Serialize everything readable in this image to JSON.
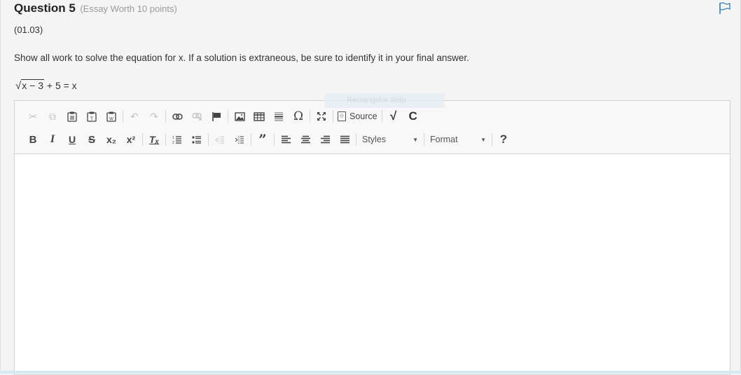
{
  "question": {
    "title": "Question 5",
    "worth": "(Essay Worth 10 points)",
    "code": "(01.03)",
    "prompt": "Show all work to solve the equation for x. If a solution is extraneous, be sure to identify it in your final answer.",
    "equation": {
      "radical_symbol": "√",
      "radicand": "x − 3",
      "rest": " + 5 = x"
    },
    "flag_icon": "flag-icon"
  },
  "overlay": {
    "snip_label": "Rectangular Snip"
  },
  "colors": {
    "accent": "#3b7fc4",
    "background": "#f4f4f4",
    "toolbar_bg": "#f8f8f8",
    "border": "#d1d1d1"
  },
  "toolbar": {
    "row1": [
      {
        "name": "cut-button",
        "icon": "✂",
        "title": "Cut",
        "disabled": true
      },
      {
        "name": "copy-button",
        "icon": "⧉",
        "title": "Copy",
        "disabled": true
      },
      {
        "name": "paste-button",
        "icon": "📋",
        "title": "Paste",
        "disabled": false
      },
      {
        "name": "paste-text-button",
        "icon": "T",
        "title": "Paste as plain text",
        "disabled": false
      },
      {
        "name": "paste-word-button",
        "icon": "W",
        "title": "Paste from Word",
        "disabled": false
      },
      {
        "name": "undo-button",
        "icon": "↶",
        "title": "Undo",
        "disabled": true
      },
      {
        "name": "redo-button",
        "icon": "↷",
        "title": "Redo",
        "disabled": true
      },
      {
        "name": "link-button",
        "icon": "🔗",
        "title": "Link",
        "disabled": false
      },
      {
        "name": "unlink-button",
        "icon": "⛓",
        "title": "Unlink",
        "disabled": true
      },
      {
        "name": "anchor-button",
        "icon": "⚑",
        "title": "Anchor",
        "disabled": false
      },
      {
        "name": "image-button",
        "icon": "🖼",
        "title": "Image",
        "disabled": false
      },
      {
        "name": "table-button",
        "icon": "▦",
        "title": "Table",
        "disabled": false
      },
      {
        "name": "horizontal-line-button",
        "icon": "☰",
        "title": "Insert Horizontal Line",
        "disabled": false
      },
      {
        "name": "special-char-button",
        "icon": "Ω",
        "title": "Insert Special Character",
        "disabled": false
      },
      {
        "name": "maximize-button",
        "icon": "⤢",
        "title": "Maximize",
        "disabled": false
      }
    ],
    "source_label": "Source",
    "sqrt_icon": "√",
    "c_icon": "C",
    "row2": [
      {
        "name": "bold-button",
        "icon": "B",
        "title": "Bold"
      },
      {
        "name": "italic-button",
        "icon": "I",
        "title": "Italic"
      },
      {
        "name": "underline-button",
        "icon": "U",
        "title": "Underline"
      },
      {
        "name": "strike-button",
        "icon": "S",
        "title": "Strikethrough"
      },
      {
        "name": "subscript-button",
        "icon": "x₂",
        "title": "Subscript"
      },
      {
        "name": "superscript-button",
        "icon": "x²",
        "title": "Superscript"
      },
      {
        "name": "remove-format-button",
        "icon": "Tₓ",
        "title": "Remove Format"
      },
      {
        "name": "numbered-list-button",
        "icon": "≔",
        "title": "Insert/Remove Numbered List"
      },
      {
        "name": "bulleted-list-button",
        "icon": "⁝≡",
        "title": "Insert/Remove Bulleted List"
      },
      {
        "name": "outdent-button",
        "icon": "⇤",
        "title": "Decrease Indent",
        "disabled": true
      },
      {
        "name": "indent-button",
        "icon": "⇥",
        "title": "Increase Indent"
      },
      {
        "name": "blockquote-button",
        "icon": "❞",
        "title": "Block Quote"
      },
      {
        "name": "align-left-button",
        "icon": "≡",
        "title": "Align Left"
      },
      {
        "name": "align-center-button",
        "icon": "≡",
        "title": "Center"
      },
      {
        "name": "align-right-button",
        "icon": "≡",
        "title": "Align Right"
      },
      {
        "name": "justify-button",
        "icon": "≣",
        "title": "Justify"
      }
    ],
    "styles_label": "Styles",
    "format_label": "Format",
    "dropdown_arrow": "▼",
    "help_label": "?"
  },
  "editor": {
    "content": ""
  }
}
